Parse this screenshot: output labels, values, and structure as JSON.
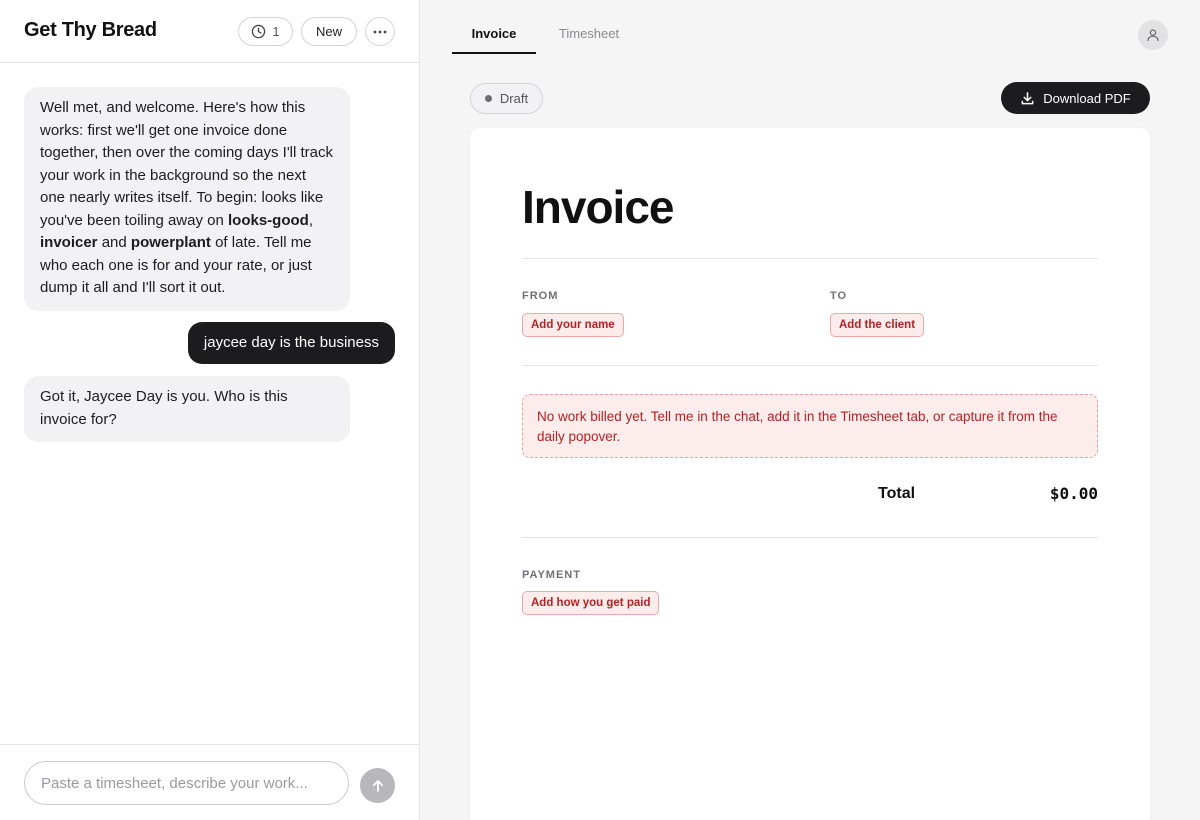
{
  "app": {
    "title": "Get Thy Bread"
  },
  "header": {
    "history_icon": "clock-icon",
    "history_count": "1",
    "new_label": "New",
    "more_icon": "ellipsis-icon"
  },
  "chat": {
    "messages": [
      {
        "role": "assistant",
        "text_before": "Well met, and welcome. Here's how this works: first we'll get one invoice done together, then over the coming days I'll track your work in the background so the next one nearly writes itself. To begin: looks like you've been toiling away on ",
        "project_1": "looks-good",
        "sep_1": ", ",
        "project_2": "invoicer",
        "sep_2": " and ",
        "project_3": "powerplant",
        "text_after": " of late. Tell me who each one is for and your rate, or just dump it all and I'll sort it out."
      },
      {
        "role": "user",
        "text": "jaycee day is the business"
      },
      {
        "role": "assistant",
        "text": "Got it, Jaycee Day is you. Who is this invoice for?"
      }
    ]
  },
  "composer": {
    "placeholder": "Paste a timesheet, describe your work...",
    "value": "",
    "send_icon": "arrow-up-icon"
  },
  "tabs": [
    {
      "label": "Invoice",
      "active": true
    },
    {
      "label": "Timesheet",
      "active": false
    }
  ],
  "avatar_icon": "user-icon",
  "invoice": {
    "status": "Draft",
    "download_label": "Download PDF",
    "download_icon": "download-icon",
    "title": "Invoice",
    "from_label": "FROM",
    "from_placeholder": "Add your name",
    "to_label": "TO",
    "to_placeholder": "Add the client",
    "empty_notice": "No work billed yet. Tell me in the chat, add it in the Timesheet tab, or capture it from the daily popover.",
    "total_label": "Total",
    "total_value": "$0.00",
    "payment_label": "PAYMENT",
    "payment_placeholder": "Add how you get paid"
  },
  "colors": {
    "accent_dark": "#1c1c1e",
    "warning_text": "#b42323",
    "warning_bg": "#fdecec",
    "warning_border": "#f0a7a7"
  }
}
